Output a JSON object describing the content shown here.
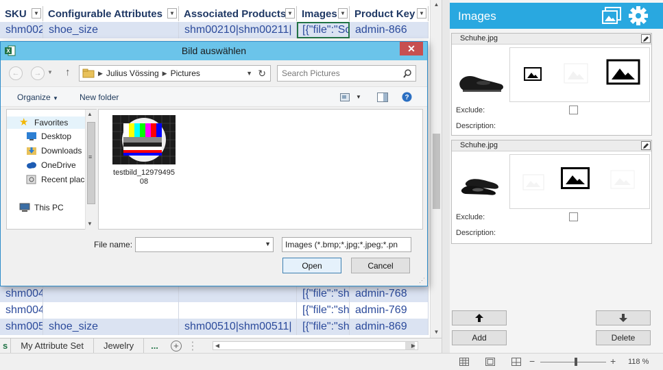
{
  "sheet": {
    "headers": [
      "SKU",
      "Configurable Attributes",
      "Associated Products",
      "Images",
      "Product Key"
    ],
    "rows_top": [
      {
        "sku": "shm002",
        "attr": "shoe_size",
        "assoc": "shm00210|shm00211|",
        "images": "[{\"file\":\"Sc",
        "key": "admin-866"
      }
    ],
    "rows_bottom": [
      {
        "sku": "shm004",
        "attr": "",
        "assoc": "",
        "images": "[{\"file\":\"sh",
        "key": "admin-768"
      },
      {
        "sku": "shm004",
        "attr": "",
        "assoc": "",
        "images": "[{\"file\":\"sh",
        "key": "admin-769"
      },
      {
        "sku": "shm005",
        "attr": "shoe_size",
        "assoc": "shm00510|shm00511|",
        "images": "[{\"file\":\"sh",
        "key": "admin-869"
      }
    ],
    "tabs": [
      "s",
      "My Attribute Set",
      "Jewelry",
      "..."
    ]
  },
  "status": {
    "zoom": "118 %"
  },
  "pane": {
    "title": "Images",
    "cards": [
      {
        "filename": "Schuhe.jpg",
        "exclude_label": "Exclude:",
        "description_label": "Description:"
      },
      {
        "filename": "Schuhe.jpg",
        "exclude_label": "Exclude:",
        "description_label": "Description:"
      }
    ],
    "add_label": "Add",
    "delete_label": "Delete"
  },
  "dialog": {
    "title": "Bild auswählen",
    "path": [
      "Julius Vössing",
      "Pictures"
    ],
    "search_placeholder": "Search Pictures",
    "organize_label": "Organize",
    "new_folder_label": "New folder",
    "nav": {
      "favorites": "Favorites",
      "items": [
        "Desktop",
        "Downloads",
        "OneDrive",
        "Recent place"
      ],
      "this_pc": "This PC"
    },
    "file": {
      "name_line1": "testbild_12979495",
      "name_line2": "08"
    },
    "filename_label": "File name:",
    "filename_value": "",
    "filetype": "Images (*.bmp;*.jpg;*.jpeg;*.pn",
    "open_label": "Open",
    "cancel_label": "Cancel"
  },
  "colors": {
    "accent": "#29a8e0",
    "excel_green": "#217346",
    "dialog_title": "#6bc4ea"
  }
}
